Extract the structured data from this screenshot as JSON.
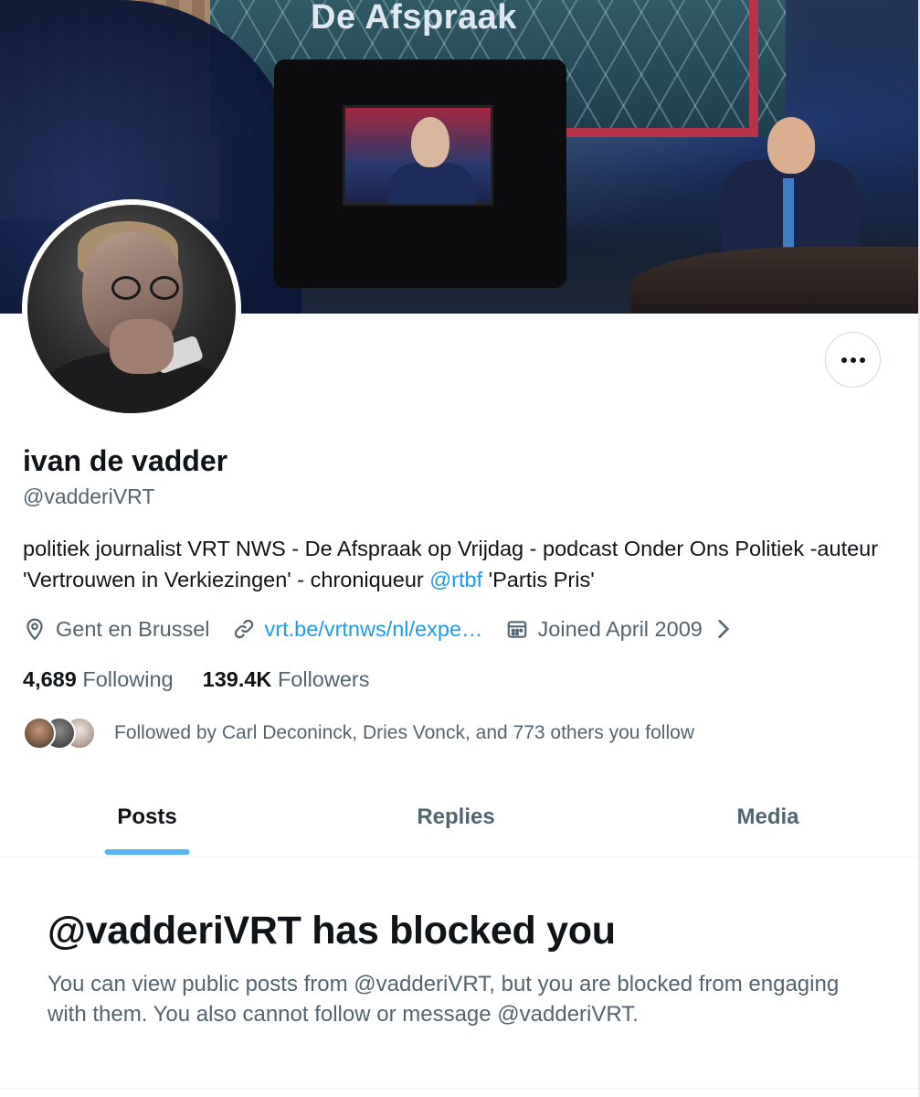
{
  "banner": {
    "show_title": "De Afspraak"
  },
  "profile": {
    "display_name": "ivan de vadder",
    "handle": "@vadderiVRT",
    "bio_part1": "politiek journalist VRT NWS - De Afspraak op Vrijdag - podcast Onder Ons Politiek -auteur 'Vertrouwen in Verkiezingen' - chroniqueur ",
    "bio_mention": "@rtbf",
    "bio_part2": " 'Partis Pris'",
    "location": "Gent en Brussel",
    "website": "vrt.be/vrtnws/nl/expe…",
    "joined": "Joined April 2009"
  },
  "stats": {
    "following_count": "4,689",
    "following_label": "Following",
    "followers_count": "139.4K",
    "followers_label": "Followers"
  },
  "followed_by": {
    "text": "Followed by Carl Deconinck, Dries Vonck, and 773 others you follow"
  },
  "tabs": [
    {
      "label": "Posts",
      "active": true
    },
    {
      "label": "Replies",
      "active": false
    },
    {
      "label": "Media",
      "active": false
    }
  ],
  "blocked": {
    "title": "@vadderiVRT has blocked you",
    "description": "You can view public posts from @vadderiVRT, but you are blocked from engaging with them. You also cannot follow or message @vadderiVRT."
  },
  "icons": {
    "more": "more-icon",
    "location": "location-icon",
    "link": "link-icon",
    "calendar": "calendar-icon",
    "chevron": "chevron-right-icon"
  },
  "colors": {
    "accent": "#1d9bf0",
    "text_primary": "#0f1419",
    "text_secondary": "#536471"
  }
}
